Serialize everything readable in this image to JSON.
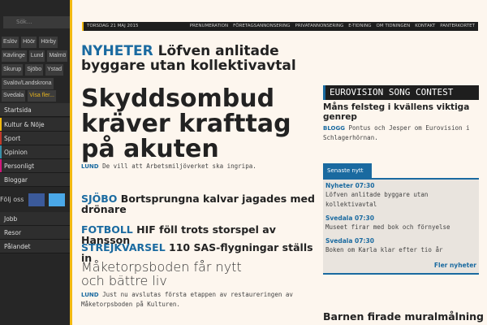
{
  "sidebar": {
    "search_placeholder": "Sök...",
    "tags": [
      "Eslöv",
      "Höör",
      "Hörby",
      "Kävlinge",
      "Lund",
      "Malmö",
      "Skurup",
      "Sjöbo",
      "Ystad",
      "Svalöv/Landskrona",
      "Svedala"
    ],
    "more_tag": "Visa fler...",
    "nav": [
      {
        "label": "Startsida",
        "color": ""
      },
      {
        "label": "Kultur & Nöje",
        "color": "#f2b90f"
      },
      {
        "label": "Sport",
        "color": "#c0392b"
      },
      {
        "label": "Opinion",
        "color": "#3a8fa8"
      },
      {
        "label": "Personligt",
        "color": "#d0177a"
      },
      {
        "label": "Bloggar",
        "color": ""
      }
    ],
    "follow_label": "Följ oss",
    "nav2": [
      "Jobb",
      "Resor",
      "Pålandet"
    ]
  },
  "topbar": {
    "date": "TORSDAG 21 MAJ 2015",
    "links": [
      "PRENUMERATION",
      "FÖRETAGSANNONSERING",
      "PRIVATANNONSERING",
      "E-TIDNING",
      "OM TIDNINGEN",
      "KONTAKT",
      "PANTERKORTET"
    ]
  },
  "main": {
    "lead": {
      "kicker": "NYHETER",
      "title": "Löfven anlitade byggare utan kollektivavtal"
    },
    "big": {
      "title": "Skyddsombud kräver krafttag på akuten",
      "kicker": "LUND",
      "summary": "De vill att Arbetsmiljöverket ska ingripa."
    },
    "items": [
      {
        "kicker": "SJÖBO",
        "title": "Bortsprungna kalvar jagades med drönare"
      },
      {
        "kicker": "FOTBOLL",
        "title": "HIF föll trots storspel av Hansson"
      },
      {
        "kicker": "STREJKVARSEL",
        "title": "110 SAS-flygningar ställs in"
      }
    ],
    "feature": {
      "title": "Måketorpsboden får nytt och bättre liv",
      "kicker": "LUND",
      "summary": "Just nu avslutas första etappen av restaureringen av Måketorpsboden på Kulturen."
    }
  },
  "right": {
    "euro_header": "EUROVISION SONG CONTEST",
    "euro_title": "Måns felsteg i kvällens viktiga genrep",
    "euro_kicker": "BLOGG",
    "euro_summary": "Pontus och Jesper om Eurovision i Schlagerhörnan.",
    "latest_tab": "Senaste nytt",
    "latest": [
      {
        "time": "Nyheter 07:30",
        "text": "Löfven anlitade byggare utan kollektivavtal"
      },
      {
        "time": "Svedala 07:30",
        "text": "Museet firar med bok och förnyelse"
      },
      {
        "time": "Svedala 07:30",
        "text": "Boken om Karla klar efter tio år"
      }
    ],
    "more": "Fler nyheter",
    "bottom_title": "Barnen firade muralmålning"
  }
}
